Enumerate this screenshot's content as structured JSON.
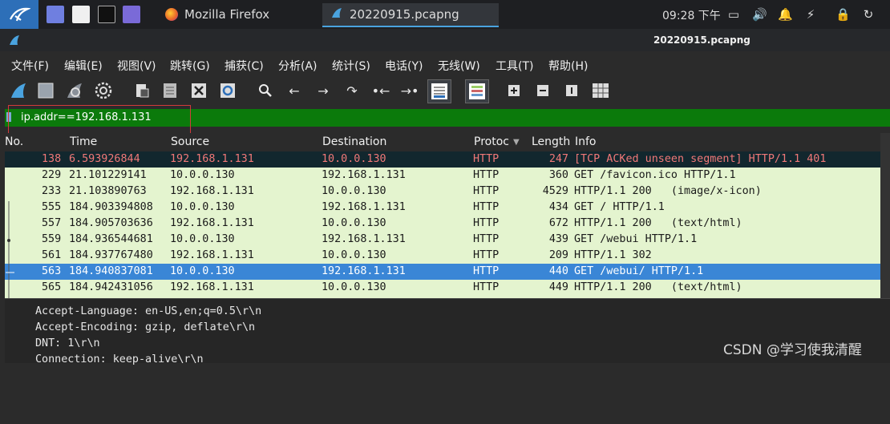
{
  "taskbar": {
    "firefox_label": "Mozilla Firefox",
    "wireshark_label": "20220915.pcapng",
    "clock": "09:28 下午"
  },
  "window": {
    "title": "20220915.pcapng"
  },
  "menu": [
    "文件(F)",
    "编辑(E)",
    "视图(V)",
    "跳转(G)",
    "捕获(C)",
    "分析(A)",
    "统计(S)",
    "电话(Y)",
    "无线(W)",
    "工具(T)",
    "帮助(H)"
  ],
  "filter": {
    "value": "ip.addr==192.168.1.131"
  },
  "columns": [
    "No.",
    "Time",
    "Source",
    "Destination",
    "Protoc",
    "Length",
    "Info"
  ],
  "packets": [
    {
      "no": "138",
      "time": "6.593926844",
      "src": "192.168.1.131",
      "dst": "10.0.0.130",
      "proto": "HTTP",
      "len": "247",
      "info": "[TCP ACKed unseen segment] HTTP/1.1 401"
    },
    {
      "no": "229",
      "time": "21.101229141",
      "src": "10.0.0.130",
      "dst": "192.168.1.131",
      "proto": "HTTP",
      "len": "360",
      "info": "GET /favicon.ico HTTP/1.1"
    },
    {
      "no": "233",
      "time": "21.103890763",
      "src": "192.168.1.131",
      "dst": "10.0.0.130",
      "proto": "HTTP",
      "len": "4529",
      "info": "HTTP/1.1 200   (image/x-icon)"
    },
    {
      "no": "555",
      "time": "184.903394808",
      "src": "10.0.0.130",
      "dst": "192.168.1.131",
      "proto": "HTTP",
      "len": "434",
      "info": "GET / HTTP/1.1"
    },
    {
      "no": "557",
      "time": "184.905703636",
      "src": "192.168.1.131",
      "dst": "10.0.0.130",
      "proto": "HTTP",
      "len": "672",
      "info": "HTTP/1.1 200   (text/html)"
    },
    {
      "no": "559",
      "time": "184.936544681",
      "src": "10.0.0.130",
      "dst": "192.168.1.131",
      "proto": "HTTP",
      "len": "439",
      "info": "GET /webui HTTP/1.1"
    },
    {
      "no": "561",
      "time": "184.937767480",
      "src": "192.168.1.131",
      "dst": "10.0.0.130",
      "proto": "HTTP",
      "len": "209",
      "info": "HTTP/1.1 302"
    },
    {
      "no": "563",
      "time": "184.940837081",
      "src": "10.0.0.130",
      "dst": "192.168.1.131",
      "proto": "HTTP",
      "len": "440",
      "info": "GET /webui/ HTTP/1.1"
    },
    {
      "no": "565",
      "time": "184.942431056",
      "src": "192.168.1.131",
      "dst": "10.0.0.130",
      "proto": "HTTP",
      "len": "449",
      "info": "HTTP/1.1 200   (text/html)"
    }
  ],
  "details": [
    "Accept-Language: en-US,en;q=0.5\\r\\n",
    "Accept-Encoding: gzip, deflate\\r\\n",
    "DNT: 1\\r\\n",
    "Connection: keep-alive\\r\\n"
  ],
  "watermark": "CSDN @学习使我清醒",
  "colors": {
    "filter_bg": "#0b7a0b",
    "selected_row": "#3a86d6",
    "http_row": "#e4f4cf",
    "bad_row_bg": "#12272e",
    "bad_row_fg": "#f07878"
  }
}
